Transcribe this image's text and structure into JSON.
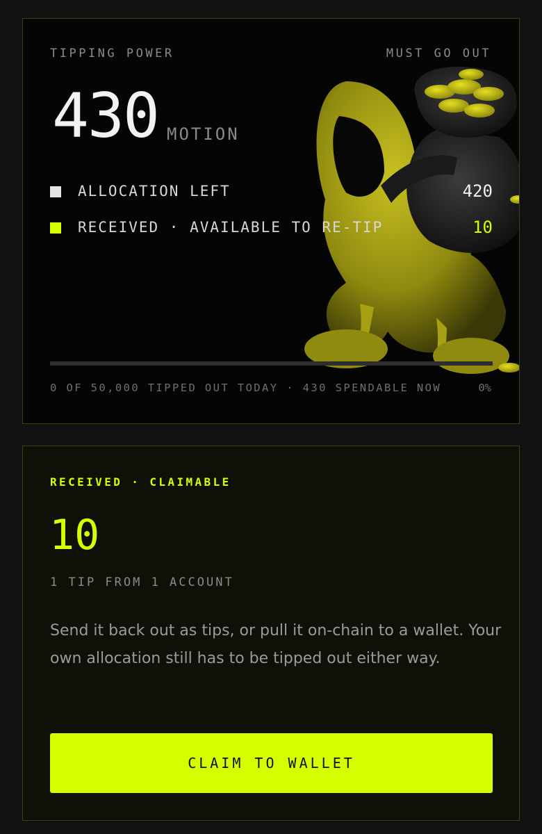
{
  "tipping_power": {
    "title": "TIPPING POWER",
    "tag": "MUST GO OUT",
    "amount": "430",
    "unit": "MOTION",
    "rows": [
      {
        "label": "ALLOCATION LEFT",
        "value": "420",
        "swatch_color": "#e6e6e6",
        "value_color": "#f2f2f2"
      },
      {
        "label": "RECEIVED · AVAILABLE TO RE-TIP",
        "value": "10",
        "swatch_color": "#d4ff00",
        "value_color": "#d4ff00"
      }
    ],
    "progress_fraction": 0,
    "footer": "0 OF 50,000 TIPPED OUT TODAY · 430 SPENDABLE NOW",
    "footer_percent": "0%",
    "illustration": "hooded-figure-carrying-coin-sack"
  },
  "claim": {
    "label": "RECEIVED · CLAIMABLE",
    "amount": "10",
    "subtitle": "1 TIP FROM 1 ACCOUNT",
    "description": "Send it back out as tips, or pull it on-chain to a wallet. Your own allocation still has to be tipped out either way.",
    "button_label": "CLAIM TO WALLET"
  },
  "colors": {
    "accent": "#d4ff00",
    "background": "#111111",
    "card_border": "#3a4212"
  }
}
